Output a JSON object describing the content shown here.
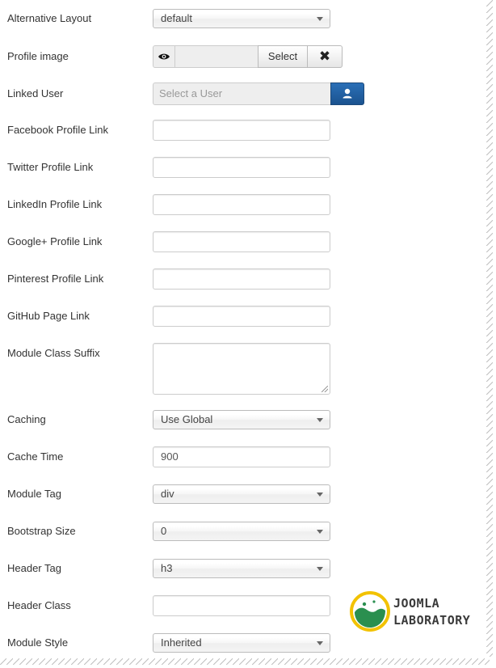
{
  "fields": {
    "alternative_layout": {
      "label": "Alternative Layout",
      "value": "default"
    },
    "profile_image": {
      "label": "Profile image",
      "select_label": "Select",
      "clear_label": "✖"
    },
    "linked_user": {
      "label": "Linked User",
      "placeholder": "Select a User"
    },
    "facebook": {
      "label": "Facebook Profile Link",
      "value": ""
    },
    "twitter": {
      "label": "Twitter Profile Link",
      "value": ""
    },
    "linkedin": {
      "label": "LinkedIn Profile Link",
      "value": ""
    },
    "googleplus": {
      "label": "Google+ Profile Link",
      "value": ""
    },
    "pinterest": {
      "label": "Pinterest Profile Link",
      "value": ""
    },
    "github": {
      "label": "GitHub Page Link",
      "value": ""
    },
    "module_class_suffix": {
      "label": "Module Class Suffix",
      "value": ""
    },
    "caching": {
      "label": "Caching",
      "value": "Use Global"
    },
    "cache_time": {
      "label": "Cache Time",
      "value": "900"
    },
    "module_tag": {
      "label": "Module Tag",
      "value": "div"
    },
    "bootstrap_size": {
      "label": "Bootstrap Size",
      "value": "0"
    },
    "header_tag": {
      "label": "Header Tag",
      "value": "h3"
    },
    "header_class": {
      "label": "Header Class",
      "value": ""
    },
    "module_style": {
      "label": "Module Style",
      "value": "Inherited"
    }
  },
  "logo": {
    "line1": "JOOMLA",
    "line2": "LABORATORY",
    "colors": {
      "ring": "#f2c200",
      "green": "#2a8f4f"
    }
  },
  "colors": {
    "user_button": "#1f5c9e",
    "label_text": "#333333",
    "input_border": "#cccccc"
  },
  "icons": {
    "preview": "eye-icon",
    "clear": "close-icon",
    "user": "user-icon",
    "dropdown": "chevron-down-icon"
  }
}
